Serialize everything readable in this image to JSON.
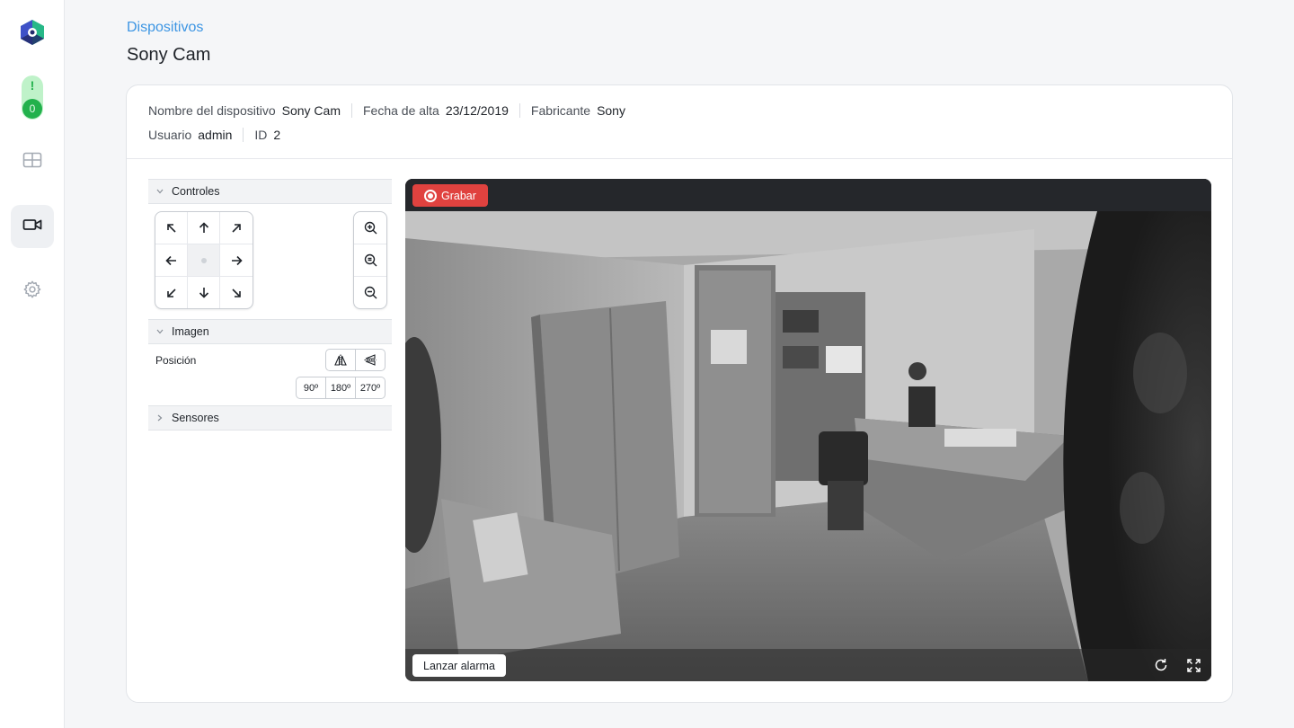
{
  "sidebar": {
    "alert_symbol": "!",
    "alert_count": "0",
    "nav": [
      "dashboard-icon",
      "camera-icon",
      "settings-icon"
    ],
    "active": "camera-icon"
  },
  "header": {
    "breadcrumb": "Dispositivos",
    "title": "Sony Cam"
  },
  "device": {
    "name_label": "Nombre del dispositivo",
    "name_value": "Sony Cam",
    "date_label": "Fecha de alta",
    "date_value": "23/12/2019",
    "maker_label": "Fabricante",
    "maker_value": "Sony",
    "user_label": "Usuario",
    "user_value": "admin",
    "id_label": "ID",
    "id_value": "2"
  },
  "panel": {
    "controls_title": "Controles",
    "image_title": "Imagen",
    "position_label": "Posición",
    "rotations": [
      "90º",
      "180º",
      "270º"
    ],
    "sensors_title": "Sensores"
  },
  "video": {
    "record_label": "Grabar",
    "alarm_label": "Lanzar alarma"
  },
  "colors": {
    "accent_blue": "#3c95e3",
    "record_red": "#e0423f",
    "alert_green": "#22b14c"
  }
}
